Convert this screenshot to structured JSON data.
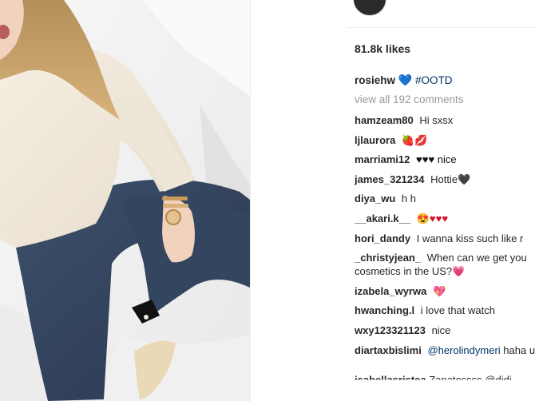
{
  "post": {
    "likes": "81.8k likes",
    "caption": {
      "username": "rosiehw",
      "emoji": "💙",
      "hashtag": "#OOTD"
    },
    "view_all": "view all 192 comments"
  },
  "comments": [
    {
      "username": "hamzeam80",
      "text": "Hi sxsx"
    },
    {
      "username": "ljlaurora",
      "text": "🍓💋"
    },
    {
      "username": "marriami12",
      "text": "♥♥♥ nice"
    },
    {
      "username": "james_321234",
      "text": "Hottie🖤"
    },
    {
      "username": "diya_wu",
      "text": "h h"
    },
    {
      "username": "__akari.k__",
      "text": "😍♥♥♥"
    },
    {
      "username": "hori_dandy",
      "text": "I wanna kiss such like r"
    },
    {
      "username": "_christyjean_",
      "text": "When can we get you cosmetics in the US?💗"
    },
    {
      "username": "izabela_wyrwa",
      "text": "💖"
    },
    {
      "username": "hwanching.l",
      "text": "i love that watch"
    },
    {
      "username": "wxy123321123",
      "text": "nice"
    },
    {
      "username": "diartaxbislimi",
      "mention": "@herolindymeri",
      "text": " haha uba😜"
    }
  ],
  "cut_comment": {
    "username": "isabellasristea",
    "text": "Zapatossss @didi"
  },
  "icons": {
    "avatar": "profile-avatar",
    "caption_heart": "blue-heart-emoji"
  }
}
